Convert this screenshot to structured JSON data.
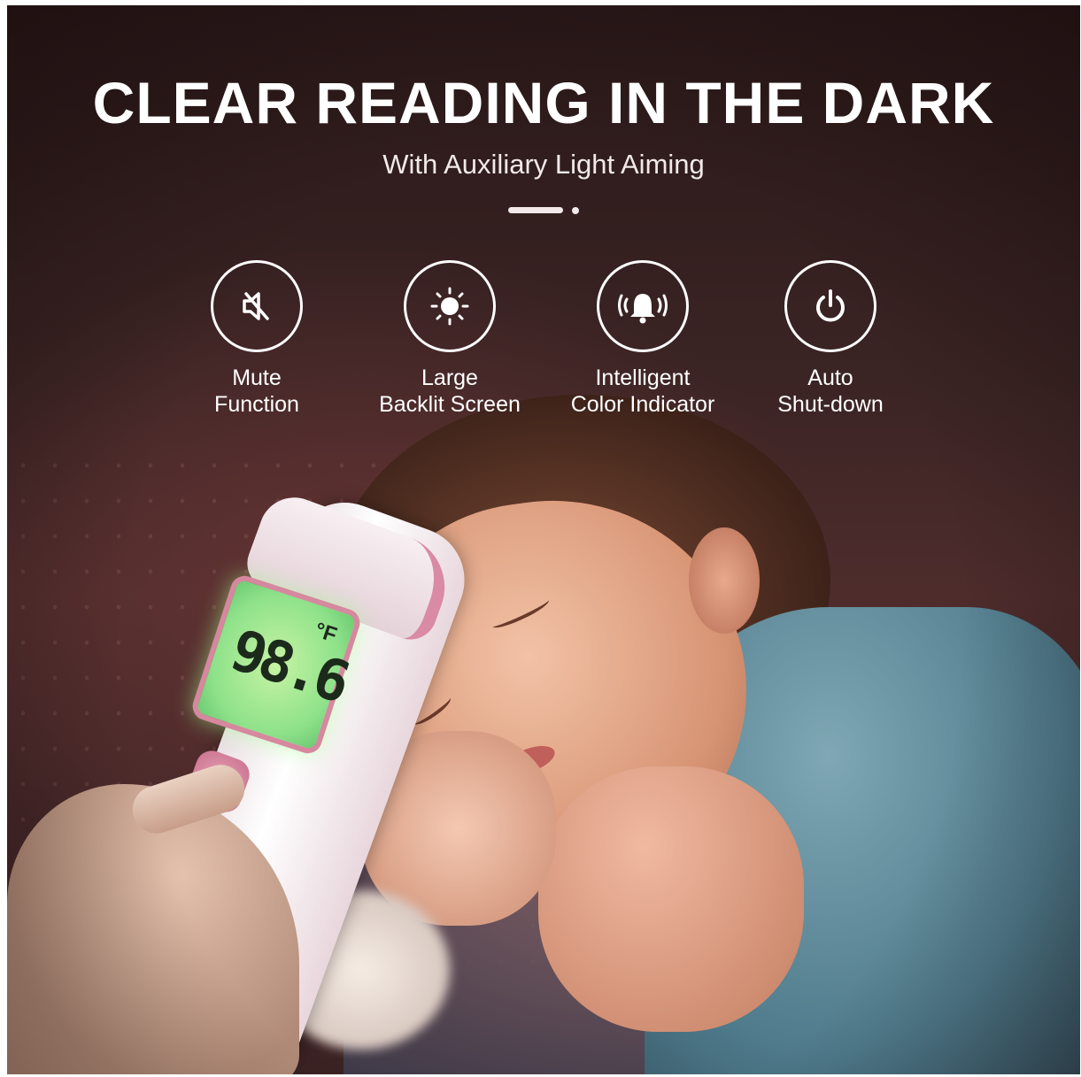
{
  "header": {
    "title": "CLEAR READING IN THE DARK",
    "subtitle": "With Auxiliary Light Aiming"
  },
  "features": [
    {
      "icon": "mute-icon",
      "line1": "Mute",
      "line2": "Function"
    },
    {
      "icon": "sun-icon",
      "line1": "Large",
      "line2": "Backlit Screen"
    },
    {
      "icon": "alarm-bell-icon",
      "line1": "Intelligent",
      "line2": "Color Indicator"
    },
    {
      "icon": "power-icon",
      "line1": "Auto",
      "line2": "Shut-down"
    }
  ],
  "display": {
    "reading": "98.6",
    "unit": "°F"
  },
  "colors": {
    "lcd_backlight": "#8fe28a",
    "accent_pink": "#d98aa4",
    "text": "#ffffff"
  }
}
